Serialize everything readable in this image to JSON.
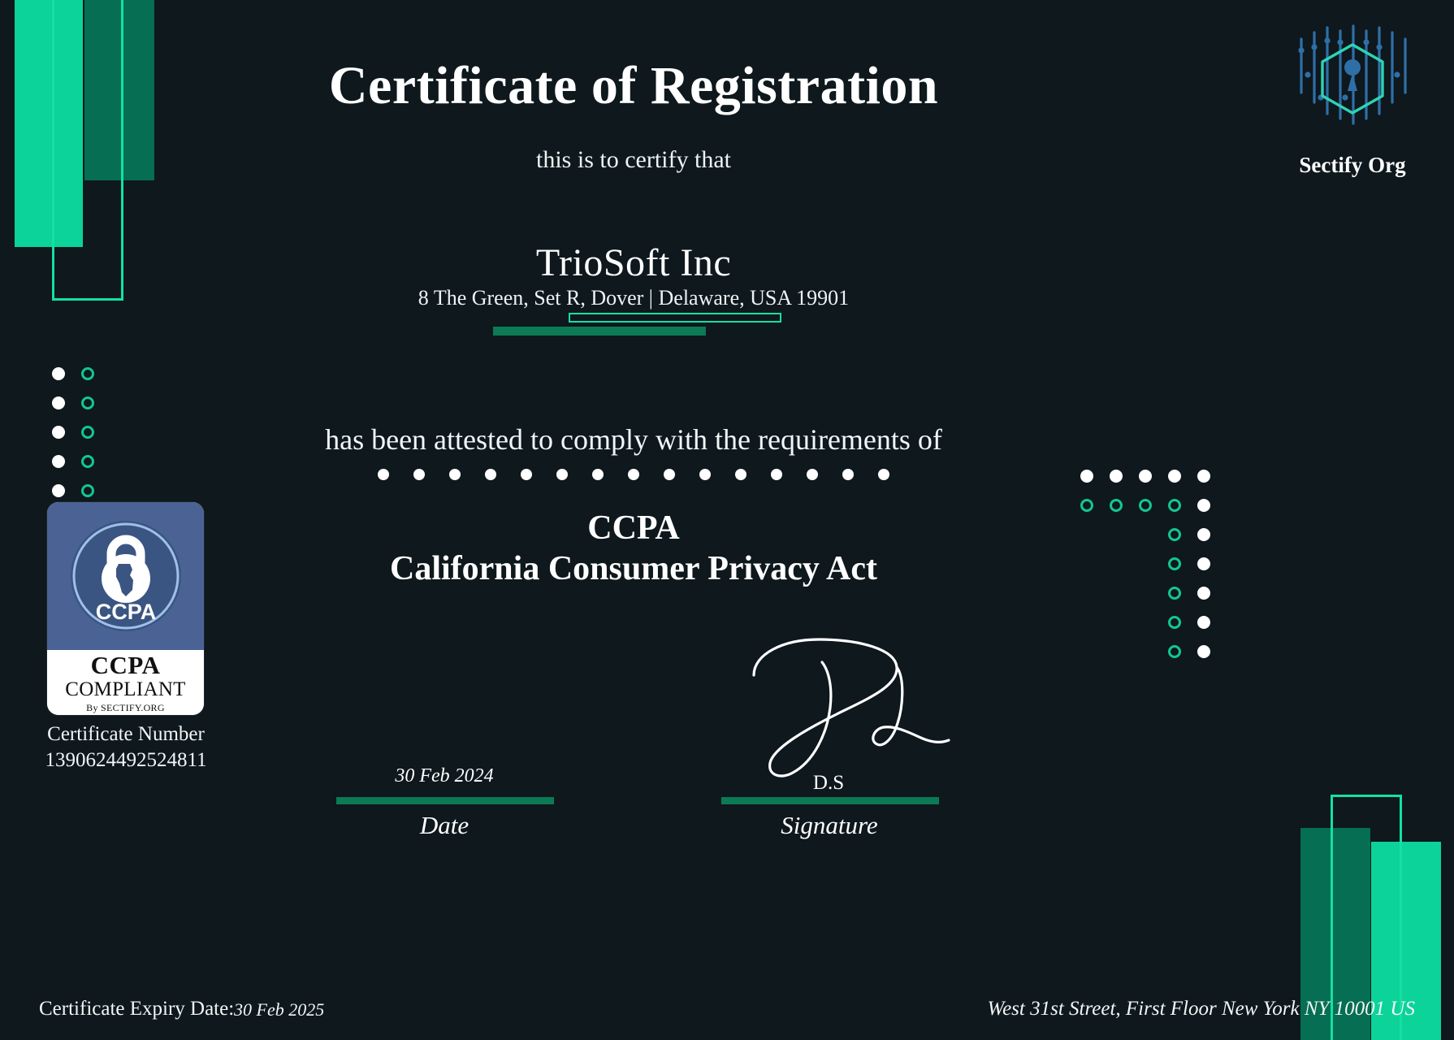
{
  "certificate": {
    "title": "Certificate of Registration",
    "subtitle": "this is to certify that",
    "recipient_name": "TrioSoft Inc",
    "recipient_address": "8 The Green, Set R, Dover | Delaware, USA 19901",
    "statement": "has been attested to comply with the requirements of",
    "standard_abbr": "CCPA",
    "standard_full": "California Consumer Privacy Act",
    "certificate_number_label": "Certificate Number",
    "certificate_number": "1390624492524811",
    "expiry_label": "Certificate Expiry Date:",
    "expiry_date": "30 Feb 2025"
  },
  "issuer": {
    "name": "Sectify Org",
    "address": "West 31st Street, First Floor New York NY 10001 US"
  },
  "badge": {
    "seal_text": "CCPA",
    "word_line1": "CCPA",
    "word_line2": "COMPLIANT",
    "by_line": "By SECTIFY.ORG"
  },
  "signature_block": {
    "date_value": "30 Feb 2024",
    "date_label": "Date",
    "signature_initials": "D.S",
    "signature_label": "Signature"
  },
  "theme": {
    "background": "#0e181d",
    "accent_bright": "#0bd39a",
    "accent_dark": "#066e52",
    "accent_outline": "#13e0a5",
    "ring": "#13c78e",
    "badge_blue": "#4a6394",
    "logo_teal": "#2fd3b4",
    "logo_blue": "#2f6fa8",
    "text": "#ffffff"
  },
  "decor": {
    "dot_separator_count": 15
  }
}
